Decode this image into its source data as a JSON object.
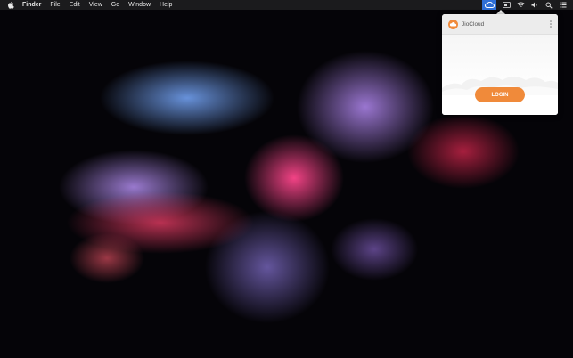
{
  "menubar": {
    "app_name": "Finder",
    "items": [
      "File",
      "Edit",
      "View",
      "Go",
      "Window",
      "Help"
    ]
  },
  "status_icons": [
    "jiocloud-icon",
    "display-icon",
    "wifi-icon",
    "volume-icon",
    "search-icon",
    "list-icon"
  ],
  "popover": {
    "brand": "JioCloud",
    "login_label": "LOGIN",
    "colors": {
      "accent": "#f08a3a",
      "header_bg": "#ececec"
    }
  }
}
